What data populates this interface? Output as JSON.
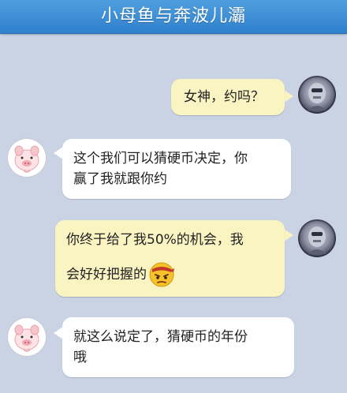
{
  "header": {
    "title": "小母鱼与奔波儿灞"
  },
  "messages": [
    {
      "sender": "me",
      "avatar_icon": "robot-avatar-icon",
      "lines": [
        "女神，约吗？"
      ]
    },
    {
      "sender": "other",
      "avatar_icon": "pig-avatar-icon",
      "lines": [
        "这个我们可以猜硬币决定，你",
        "赢了我就跟你约"
      ]
    },
    {
      "sender": "me",
      "avatar_icon": "robot-avatar-icon",
      "lines": [
        "你终于给了我50%的机会，我",
        "会好好把握的"
      ],
      "emoji": "determined-face-emoji-icon"
    },
    {
      "sender": "other",
      "avatar_icon": "pig-avatar-icon",
      "lines": [
        "就这么说定了，猜硬币的年份",
        "哦"
      ]
    }
  ],
  "colors": {
    "background": "#c9d3e4",
    "title_bar": "#3a8ad4",
    "my_bubble": "#faf4c2",
    "other_bubble": "#ffffff"
  }
}
